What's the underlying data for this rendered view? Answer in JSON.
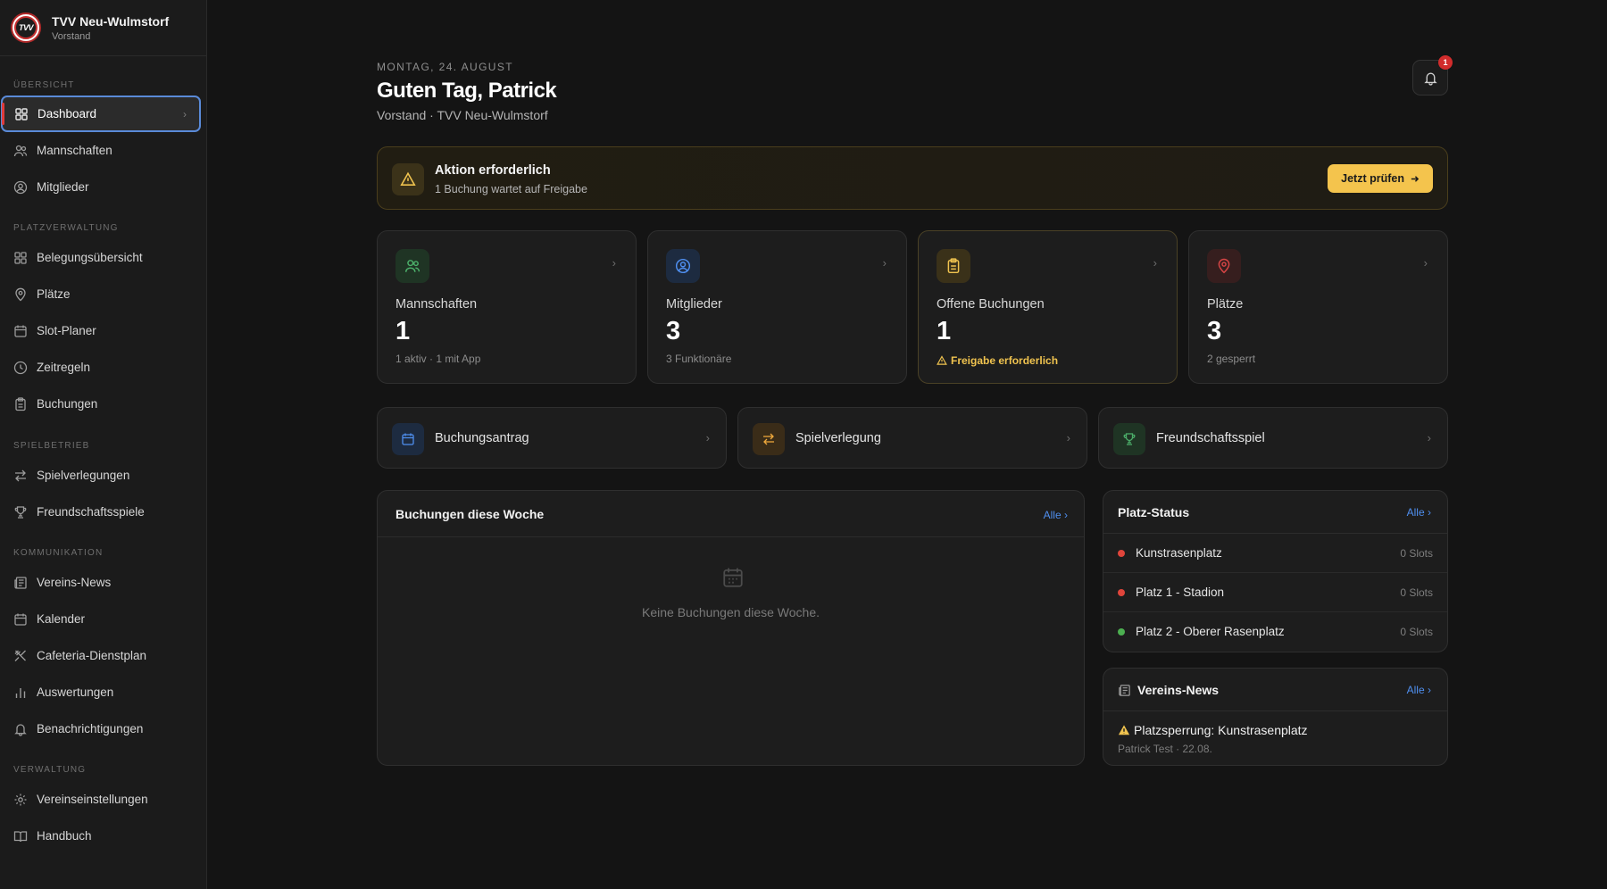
{
  "brand": {
    "title": "TVV Neu-Wulmstorf",
    "subtitle": "Vorstand",
    "logo_text": "TVV"
  },
  "sidebar": {
    "sections": [
      {
        "label": "ÜBERSICHT"
      },
      {
        "label": "PLATZVERWALTUNG"
      },
      {
        "label": "SPIELBETRIEB"
      },
      {
        "label": "KOMMUNIKATION"
      },
      {
        "label": "VERWALTUNG"
      }
    ],
    "items": [
      {
        "label": "Dashboard",
        "icon": "grid-icon",
        "active": true
      },
      {
        "label": "Mannschaften",
        "icon": "users-icon"
      },
      {
        "label": "Mitglieder",
        "icon": "user-circle-icon"
      },
      {
        "label": "Belegungsübersicht",
        "icon": "grid-icon"
      },
      {
        "label": "Plätze",
        "icon": "map-pin-icon"
      },
      {
        "label": "Slot-Planer",
        "icon": "calendar-icon"
      },
      {
        "label": "Zeitregeln",
        "icon": "clock-icon"
      },
      {
        "label": "Buchungen",
        "icon": "clipboard-icon"
      },
      {
        "label": "Spielverlegungen",
        "icon": "swap-icon"
      },
      {
        "label": "Freundschaftsspiele",
        "icon": "trophy-icon"
      },
      {
        "label": "Vereins-News",
        "icon": "newspaper-icon"
      },
      {
        "label": "Kalender",
        "icon": "calendar-icon"
      },
      {
        "label": "Cafeteria-Dienstplan",
        "icon": "utensils-icon"
      },
      {
        "label": "Auswertungen",
        "icon": "bar-chart-icon"
      },
      {
        "label": "Benachrichtigungen",
        "icon": "bell-icon"
      },
      {
        "label": "Vereinseinstellungen",
        "icon": "gear-icon"
      },
      {
        "label": "Handbuch",
        "icon": "book-icon"
      }
    ]
  },
  "header": {
    "date": "MONTAG, 24. AUGUST",
    "greeting": "Guten Tag, Patrick",
    "subline": "Vorstand · TVV Neu-Wulmstorf",
    "notification_count": "1"
  },
  "alert": {
    "title": "Aktion erforderlich",
    "subtitle": "1 Buchung wartet auf Freigabe",
    "button": "Jetzt prüfen",
    "accent": "#f4c44d"
  },
  "stats": [
    {
      "label": "Mannschaften",
      "value": "1",
      "note": "1 aktiv · 1 mit App",
      "icon": "users-icon",
      "color": "#4caf6a"
    },
    {
      "label": "Mitglieder",
      "value": "3",
      "note": "3 Funktionäre",
      "icon": "user-circle-icon",
      "color": "#4f8ff0"
    },
    {
      "label": "Offene Buchungen",
      "value": "1",
      "note": "Freigabe erforderlich",
      "icon": "clipboard-icon",
      "color": "#f0c34f"
    },
    {
      "label": "Plätze",
      "value": "3",
      "note": "2 gesperrt",
      "icon": "map-pin-icon",
      "color": "#d64545"
    }
  ],
  "quick_actions": [
    {
      "label": "Buchungsantrag",
      "icon": "calendar-icon",
      "color": "#4f8ff0"
    },
    {
      "label": "Spielverlegung",
      "icon": "swap-icon",
      "color": "#f0a93c"
    },
    {
      "label": "Freundschaftsspiel",
      "icon": "trophy-icon",
      "color": "#4caf6a"
    }
  ],
  "bookings": {
    "title": "Buchungen diese Woche",
    "link": "Alle",
    "empty": "Keine Buchungen diese Woche."
  },
  "place_status": {
    "title": "Platz-Status",
    "link": "Alle",
    "rows": [
      {
        "name": "Kunstrasenplatz",
        "slots": "0 Slots",
        "status_color": "#e0453b"
      },
      {
        "name": "Platz 1 - Stadion",
        "slots": "0 Slots",
        "status_color": "#e0453b"
      },
      {
        "name": "Platz 2 - Oberer Rasenplatz",
        "slots": "0 Slots",
        "status_color": "#4caf50"
      }
    ]
  },
  "news": {
    "title": "Vereins-News",
    "link": "Alle",
    "item_title": "Platzsperrung: Kunstrasenplatz",
    "item_meta": "Patrick Test · 22.08."
  }
}
